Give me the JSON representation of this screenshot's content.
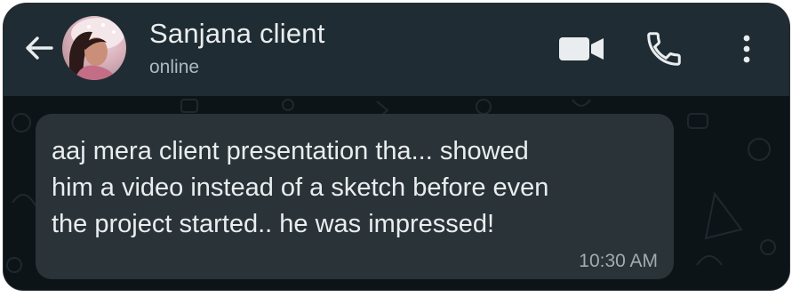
{
  "header": {
    "contact_name": "Sanjana client",
    "status": "online",
    "icons": [
      "back-arrow-icon",
      "video-call-icon",
      "phone-call-icon",
      "more-options-icon"
    ]
  },
  "message": {
    "text": "aaj mera client presentation tha... showed\nhim a video instead of a sketch before even\nthe project started.. he was impressed!",
    "time": "10:30 AM"
  },
  "colors": {
    "header_bg": "#1f2c33",
    "chat_bg": "#0d1418",
    "bubble_bg": "#2a3337",
    "text_primary": "#e9edef",
    "text_secondary": "#aebac1"
  }
}
